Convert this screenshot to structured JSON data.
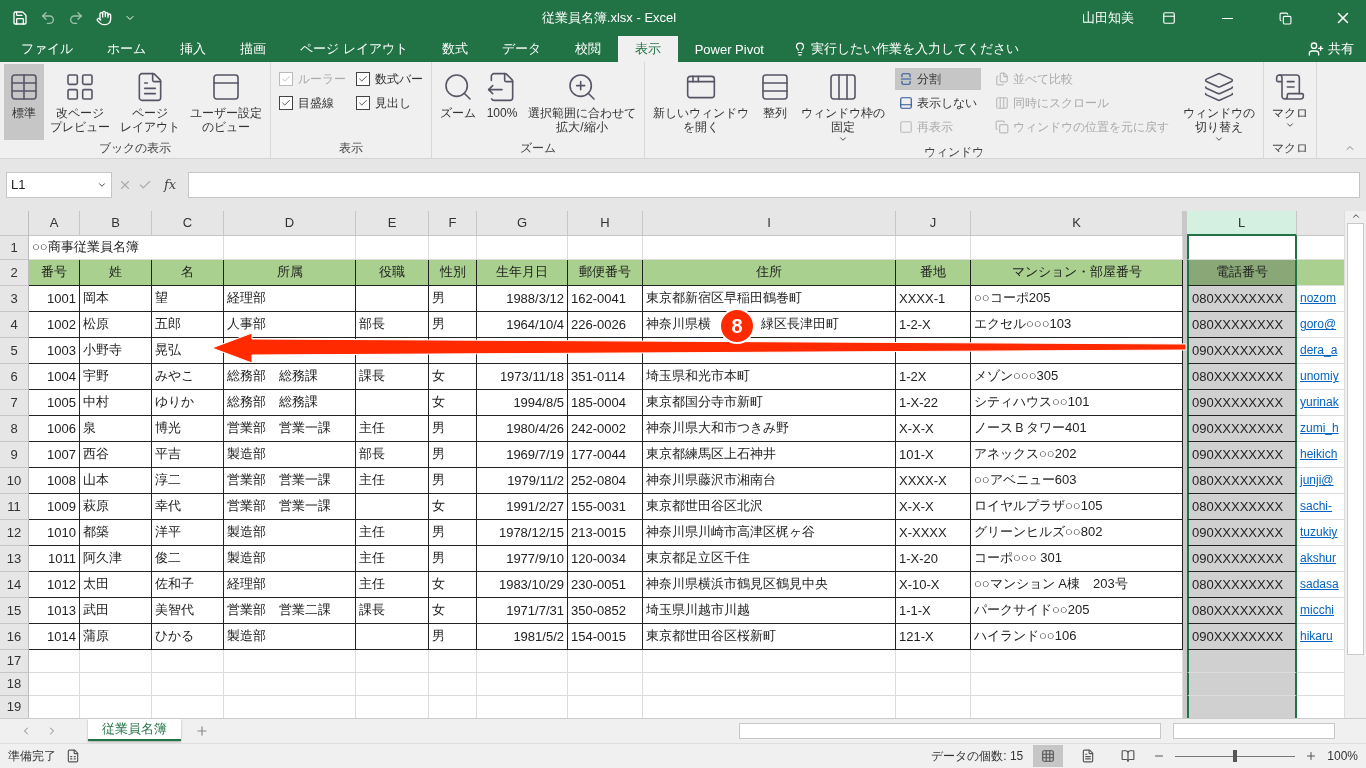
{
  "window": {
    "title": "従業員名簿.xlsx  -  Excel",
    "user": "山田知美"
  },
  "menu_tabs": [
    {
      "label": "ファイル",
      "selected": false
    },
    {
      "label": "ホーム",
      "selected": false
    },
    {
      "label": "挿入",
      "selected": false
    },
    {
      "label": "描画",
      "selected": false
    },
    {
      "label": "ページ レイアウト",
      "selected": false
    },
    {
      "label": "数式",
      "selected": false
    },
    {
      "label": "データ",
      "selected": false
    },
    {
      "label": "校閲",
      "selected": false
    },
    {
      "label": "表示",
      "selected": true
    },
    {
      "label": "Power Pivot",
      "selected": false
    }
  ],
  "tell_me": "実行したい作業を入力してください",
  "share": "共有",
  "ribbon_groups": [
    {
      "label": "ブックの表示",
      "items": [
        {
          "kind": "large",
          "label": [
            "標準"
          ],
          "selected": true
        },
        {
          "kind": "large",
          "label": [
            "改ページ",
            "プレビュー"
          ],
          "selected": false
        },
        {
          "kind": "large",
          "label": [
            "ページ",
            "レイアウト"
          ],
          "selected": false
        },
        {
          "kind": "large",
          "label": [
            "ユーザー設定",
            "のビュー"
          ],
          "selected": false
        }
      ]
    },
    {
      "label": "表示",
      "items": [
        {
          "kind": "stack",
          "items": [
            {
              "kind": "check",
              "label": "ルーラー",
              "checked": true,
              "disabled": true
            },
            {
              "kind": "check",
              "label": "目盛線",
              "checked": true,
              "disabled": false
            }
          ]
        },
        {
          "kind": "stack",
          "items": [
            {
              "kind": "check",
              "label": "数式バー",
              "checked": true,
              "disabled": false
            },
            {
              "kind": "check",
              "label": "見出し",
              "checked": true,
              "disabled": false
            }
          ]
        }
      ]
    },
    {
      "label": "ズーム",
      "items": [
        {
          "kind": "large",
          "label": [
            "ズーム"
          ],
          "selected": false
        },
        {
          "kind": "large",
          "label": [
            "100%"
          ],
          "selected": false
        },
        {
          "kind": "large",
          "label": [
            "選択範囲に合わせて",
            "拡大/縮小"
          ],
          "selected": false
        }
      ]
    },
    {
      "label": "ウィンドウ",
      "items": [
        {
          "kind": "large",
          "label": [
            "新しいウィンドウ",
            "を開く"
          ],
          "selected": false
        },
        {
          "kind": "large",
          "label": [
            "整列"
          ],
          "selected": false
        },
        {
          "kind": "large",
          "label": [
            "ウィンドウ枠の",
            "固定"
          ],
          "selected": false,
          "dropdown": true
        },
        {
          "kind": "stack",
          "items": [
            {
              "kind": "small",
              "label": "分割",
              "selected": true,
              "disabled": false
            },
            {
              "kind": "small",
              "label": "表示しない",
              "selected": false,
              "disabled": false
            },
            {
              "kind": "small",
              "label": "再表示",
              "selected": false,
              "disabled": true
            }
          ]
        },
        {
          "kind": "stack",
          "items": [
            {
              "kind": "small",
              "label": "並べて比較",
              "selected": false,
              "disabled": true
            },
            {
              "kind": "small",
              "label": "同時にスクロール",
              "selected": false,
              "disabled": true
            },
            {
              "kind": "small",
              "label": "ウィンドウの位置を元に戻す",
              "selected": false,
              "disabled": true
            }
          ]
        },
        {
          "kind": "large",
          "label": [
            "ウィンドウの",
            "切り替え"
          ],
          "selected": false,
          "dropdown": true
        }
      ]
    },
    {
      "label": "マクロ",
      "items": [
        {
          "kind": "large",
          "label": [
            "マクロ"
          ],
          "selected": false,
          "dropdown": true
        }
      ]
    }
  ],
  "name_box": "L1",
  "function_label": "fx",
  "columns": [
    {
      "letter": "A",
      "selected": false
    },
    {
      "letter": "B",
      "selected": false
    },
    {
      "letter": "C",
      "selected": false
    },
    {
      "letter": "D",
      "selected": false
    },
    {
      "letter": "E",
      "selected": false
    },
    {
      "letter": "F",
      "selected": false
    },
    {
      "letter": "G",
      "selected": false
    },
    {
      "letter": "H",
      "selected": false
    },
    {
      "letter": "I",
      "selected": false
    },
    {
      "letter": "J",
      "selected": false
    },
    {
      "letter": "K",
      "selected": false
    },
    {
      "letter": "L",
      "selected": true
    },
    {
      "selected": false
    }
  ],
  "rows": [
    {
      "number": "1",
      "kind": "title",
      "cells": [
        "○○商事従業員名簿"
      ]
    },
    {
      "number": "2",
      "kind": "header",
      "cells": [
        "番号",
        "姓",
        "名",
        "所属",
        "役職",
        "性別",
        "生年月日",
        "郵便番号",
        "住所",
        "番地",
        "マンション・部屋番号",
        "電話番号",
        ""
      ]
    },
    {
      "number": "3",
      "kind": "data",
      "cells": [
        "1001",
        "岡本",
        "望",
        "経理部",
        "",
        "男",
        "1988/3/12",
        "162-0041",
        "東京都新宿区早稲田鶴巻町",
        "XXXX-1",
        "○○コーポ205",
        "080XXXXXXXX",
        "nozom"
      ]
    },
    {
      "number": "4",
      "kind": "data",
      "cells": [
        "1002",
        "松原",
        "五郎",
        "人事部",
        "部長",
        "男",
        "1964/10/4",
        "226-0026",
        [
          "神奈川県横",
          "緑区長津田町"
        ],
        "1-2-X",
        "エクセル○○○103",
        "080XXXXXXXX",
        "goro@"
      ]
    },
    {
      "number": "5",
      "kind": "data",
      "cells": [
        "1003",
        "小野寺",
        "晃弘",
        "",
        "",
        "",
        "",
        "",
        "",
        "",
        "",
        "090XXXXXXXX",
        "dera_a"
      ]
    },
    {
      "number": "6",
      "kind": "data",
      "cells": [
        "1004",
        "宇野",
        "みやこ",
        "総務部　総務課",
        "課長",
        "女",
        "1973/11/18",
        "351-0114",
        "埼玉県和光市本町",
        "1-2X",
        "メゾン○○○305",
        "080XXXXXXXX",
        "unomiy"
      ]
    },
    {
      "number": "7",
      "kind": "data",
      "cells": [
        "1005",
        "中村",
        "ゆりか",
        "総務部　総務課",
        "",
        "女",
        "1994/8/5",
        "185-0004",
        "東京都国分寺市新町",
        "1-X-22",
        "シティハウス○○101",
        "090XXXXXXXX",
        "yurinak"
      ]
    },
    {
      "number": "8",
      "kind": "data",
      "cells": [
        "1006",
        "泉",
        "博光",
        "営業部　営業一課",
        "主任",
        "男",
        "1980/4/26",
        "242-0002",
        "神奈川県大和市つきみ野",
        "X-X-X",
        "ノースＢタワー401",
        "090XXXXXXXX",
        "zumi_h"
      ]
    },
    {
      "number": "9",
      "kind": "data",
      "cells": [
        "1007",
        "西谷",
        "平吉",
        "製造部",
        "部長",
        "男",
        "1969/7/19",
        "177-0044",
        "東京都練馬区上石神井",
        "101-X",
        "アネックス○○202",
        "090XXXXXXXX",
        "heikich"
      ]
    },
    {
      "number": "10",
      "kind": "data",
      "cells": [
        "1008",
        "山本",
        "淳二",
        "営業部　営業一課",
        "主任",
        "男",
        "1979/11/2",
        "252-0804",
        "神奈川県藤沢市湘南台",
        "XXXX-X",
        "○○アベニュー603",
        "080XXXXXXXX",
        "junji@"
      ]
    },
    {
      "number": "11",
      "kind": "data",
      "cells": [
        "1009",
        "萩原",
        "幸代",
        "営業部　営業一課",
        "",
        "女",
        "1991/2/27",
        "155-0031",
        "東京都世田谷区北沢",
        "X-X-X",
        "ロイヤルプラザ○○105",
        "080XXXXXXXX",
        "sachi-"
      ]
    },
    {
      "number": "12",
      "kind": "data",
      "cells": [
        "1010",
        "都築",
        "洋平",
        "製造部",
        "主任",
        "男",
        "1978/12/15",
        "213-0015",
        "神奈川県川崎市高津区梶ヶ谷",
        "X-XXXX",
        "グリーンヒルズ○○802",
        "090XXXXXXXX",
        "tuzukiy"
      ]
    },
    {
      "number": "13",
      "kind": "data",
      "cells": [
        "1011",
        "阿久津",
        "俊二",
        "製造部",
        "主任",
        "男",
        "1977/9/10",
        "120-0034",
        "東京都足立区千住",
        "1-X-20",
        "コーポ○○○ 301",
        "090XXXXXXXX",
        "akshur"
      ]
    },
    {
      "number": "14",
      "kind": "data",
      "cells": [
        "1012",
        "太田",
        "佐和子",
        "経理部",
        "主任",
        "女",
        "1983/10/29",
        "230-0051",
        "神奈川県横浜市鶴見区鶴見中央",
        "X-10-X",
        "○○マンション A棟　203号",
        "080XXXXXXXX",
        "sadasa"
      ]
    },
    {
      "number": "15",
      "kind": "data",
      "cells": [
        "1013",
        "武田",
        "美智代",
        "営業部　営業二課",
        "課長",
        "女",
        "1971/7/31",
        "350-0852",
        "埼玉県川越市川越",
        "1-1-X",
        "パークサイド○○205",
        "080XXXXXXXX",
        "micchi"
      ]
    },
    {
      "number": "16",
      "kind": "data",
      "cells": [
        "1014",
        "蒲原",
        "ひかる",
        "製造部",
        "",
        "男",
        "1981/5/2",
        "154-0015",
        "東京都世田谷区桜新町",
        "121-X",
        "ハイランド○○106",
        "090XXXXXXXX",
        "hikaru"
      ]
    },
    {
      "number": "17",
      "kind": "empty",
      "cells": []
    },
    {
      "number": "18",
      "kind": "empty",
      "cells": []
    },
    {
      "number": "19",
      "kind": "empty",
      "cells": []
    }
  ],
  "callout": {
    "number": "8"
  },
  "sheet_tabs": [
    {
      "label": "従業員名簿",
      "selected": true
    }
  ],
  "status_bar": {
    "ready": "準備完了",
    "count": "データの個数: 15",
    "views": [
      {
        "selected": true
      },
      {
        "selected": false
      },
      {
        "selected": false
      }
    ],
    "zoom_slider": {
      "level": 0.5
    },
    "zoom": "100%"
  }
}
